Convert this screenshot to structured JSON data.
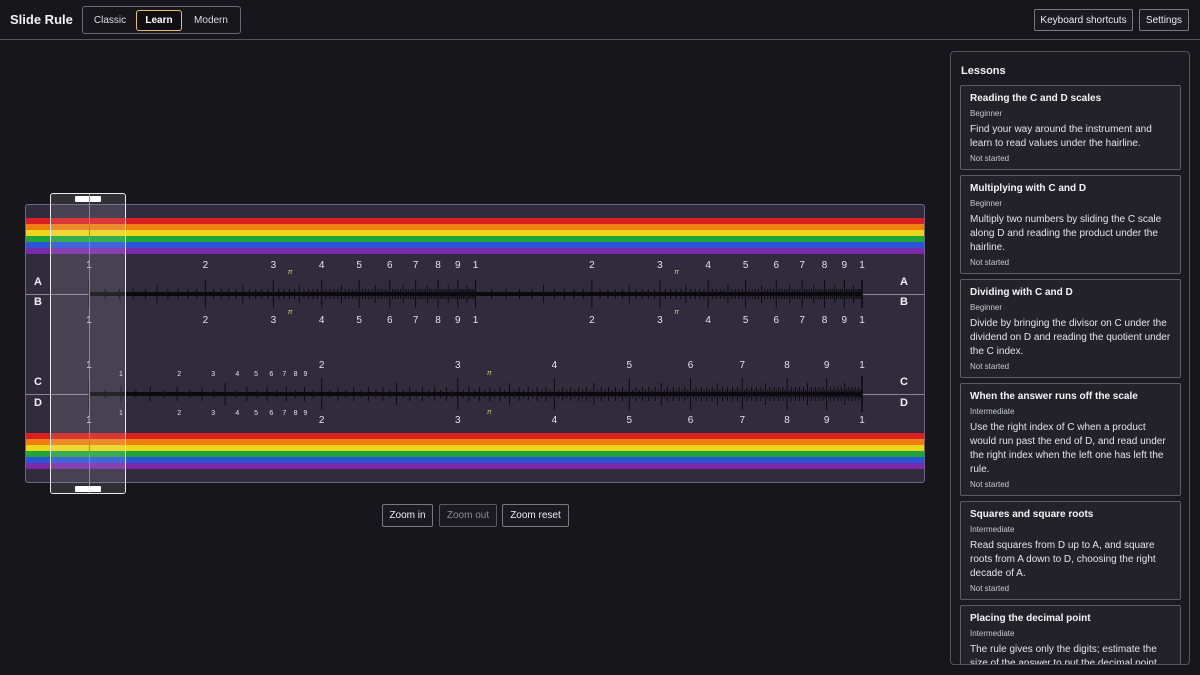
{
  "app": {
    "title": "Slide Rule"
  },
  "modes": [
    {
      "label": "Classic",
      "active": false
    },
    {
      "label": "Learn",
      "active": true
    },
    {
      "label": "Modern",
      "active": false
    }
  ],
  "header_actions": {
    "shortcuts_label": "Keyboard shortcuts",
    "settings_label": "Settings"
  },
  "rule": {
    "scales": {
      "a": "A",
      "b": "B",
      "c": "C",
      "d": "D"
    },
    "pi_symbol": "π",
    "ab_labels": [
      "1",
      "2",
      "3",
      "4",
      "5",
      "6",
      "7",
      "8",
      "9",
      "1",
      "2",
      "3",
      "4",
      "5",
      "6",
      "7",
      "8",
      "9",
      "1"
    ],
    "cd_major_labels": [
      "1",
      "2",
      "3",
      "4",
      "5",
      "6",
      "7",
      "8",
      "9",
      "1"
    ],
    "cd_minor_labels": [
      "1",
      "2",
      "3",
      "4",
      "5",
      "6",
      "7",
      "8",
      "9"
    ],
    "stripe_colors": [
      "#d91f1f",
      "#f07f10",
      "#f0d61a",
      "#1fa63a",
      "#2a55d6",
      "#7a2aa8"
    ]
  },
  "zoom": {
    "in_label": "Zoom in",
    "out_label": "Zoom out",
    "reset_label": "Zoom reset"
  },
  "lessons": {
    "title": "Lessons",
    "items": [
      {
        "title": "Reading the C and D scales",
        "level": "Beginner",
        "description": "Find your way around the instrument and learn to read values under the hairline.",
        "status": "Not started"
      },
      {
        "title": "Multiplying with C and D",
        "level": "Beginner",
        "description": "Multiply two numbers by sliding the C scale along D and reading the product under the hairline.",
        "status": "Not started"
      },
      {
        "title": "Dividing with C and D",
        "level": "Beginner",
        "description": "Divide by bringing the divisor on C under the dividend on D and reading the quotient under the C index.",
        "status": "Not started"
      },
      {
        "title": "When the answer runs off the scale",
        "level": "Intermediate",
        "description": "Use the right index of C when a product would run past the end of D, and read under the right index when the left one has left the rule.",
        "status": "Not started"
      },
      {
        "title": "Squares and square roots",
        "level": "Intermediate",
        "description": "Read squares from D up to A, and square roots from A down to D, choosing the right decade of A.",
        "status": "Not started"
      },
      {
        "title": "Placing the decimal point",
        "level": "Intermediate",
        "description": "The rule gives only the digits; estimate the size of the answer to put the decimal point where it belongs.",
        "status": ""
      }
    ]
  }
}
